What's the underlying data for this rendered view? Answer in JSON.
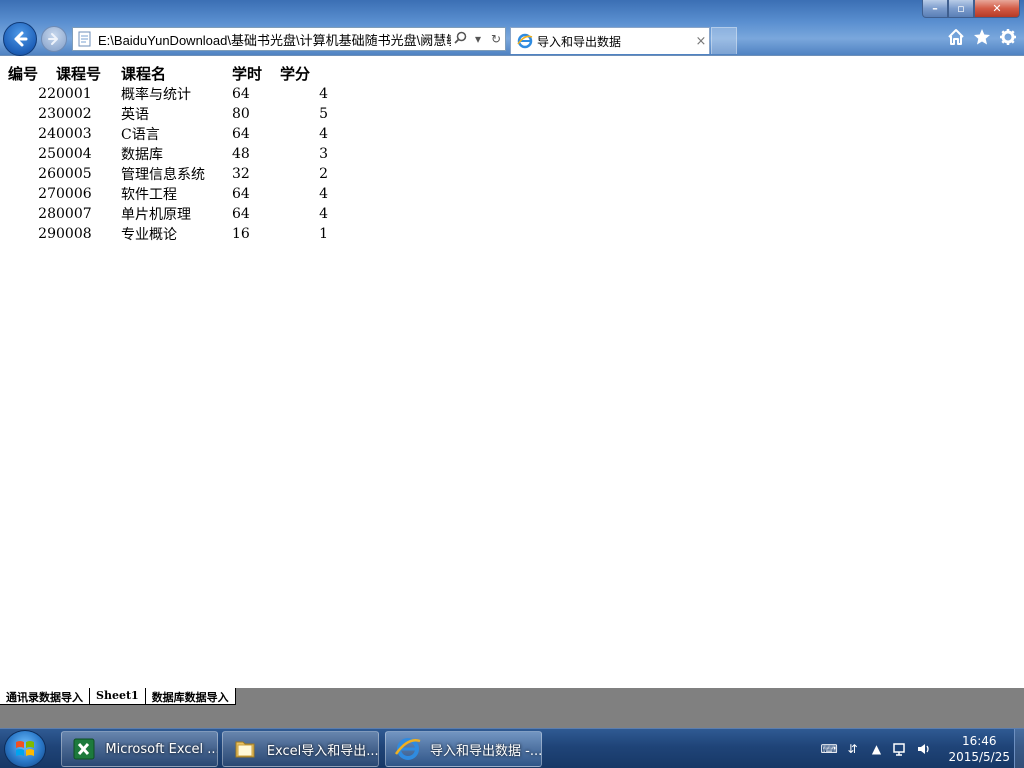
{
  "browser": {
    "address": "E:\\BaiduYunDownload\\基础书光盘\\计算机基础随书光盘\\阙慧敏-i",
    "tab_title": "导入和导出数据",
    "tab_close": "×",
    "win_min": "–",
    "win_max": "▫",
    "win_close": "✕",
    "icons": [
      "back-arrow-icon",
      "forward-arrow-icon",
      "ie-page-icon",
      "search-icon",
      "dropdown-icon",
      "refresh-icon",
      "home-icon",
      "favorites-star-icon",
      "settings-gear-icon"
    ]
  },
  "table": {
    "headers": [
      "编号",
      "课程号",
      "课程名",
      "学时",
      "学分"
    ],
    "rows": [
      {
        "id": "22",
        "code": "0001",
        "name": "概率与统计",
        "hours": "64",
        "credit": "4"
      },
      {
        "id": "23",
        "code": "0002",
        "name": "英语",
        "hours": "80",
        "credit": "5"
      },
      {
        "id": "24",
        "code": "0003",
        "name": "C语言",
        "hours": "64",
        "credit": "4"
      },
      {
        "id": "25",
        "code": "0004",
        "name": "数据库",
        "hours": "48",
        "credit": "3"
      },
      {
        "id": "26",
        "code": "0005",
        "name": "管理信息系统",
        "hours": "32",
        "credit": "2"
      },
      {
        "id": "27",
        "code": "0006",
        "name": "软件工程",
        "hours": "64",
        "credit": "4"
      },
      {
        "id": "28",
        "code": "0007",
        "name": "单片机原理",
        "hours": "64",
        "credit": "4"
      },
      {
        "id": "29",
        "code": "0008",
        "name": "专业概论",
        "hours": "16",
        "credit": "1"
      }
    ]
  },
  "sheets": [
    "通讯录数据导入",
    "Sheet1",
    "数据库数据导入"
  ],
  "taskbar": {
    "items": [
      {
        "label": "Microsoft Excel ...",
        "icon": "excel-icon"
      },
      {
        "label": "Excel导入和导出...",
        "icon": "folder-icon"
      },
      {
        "label": "导入和导出数据 -...",
        "icon": "ie-icon"
      }
    ],
    "time": "16:46",
    "date": "2015/5/25"
  },
  "colors": {
    "taskbar": "#1f4478",
    "chrome": "#5a8fd0",
    "sheet_bar": "#808080"
  }
}
